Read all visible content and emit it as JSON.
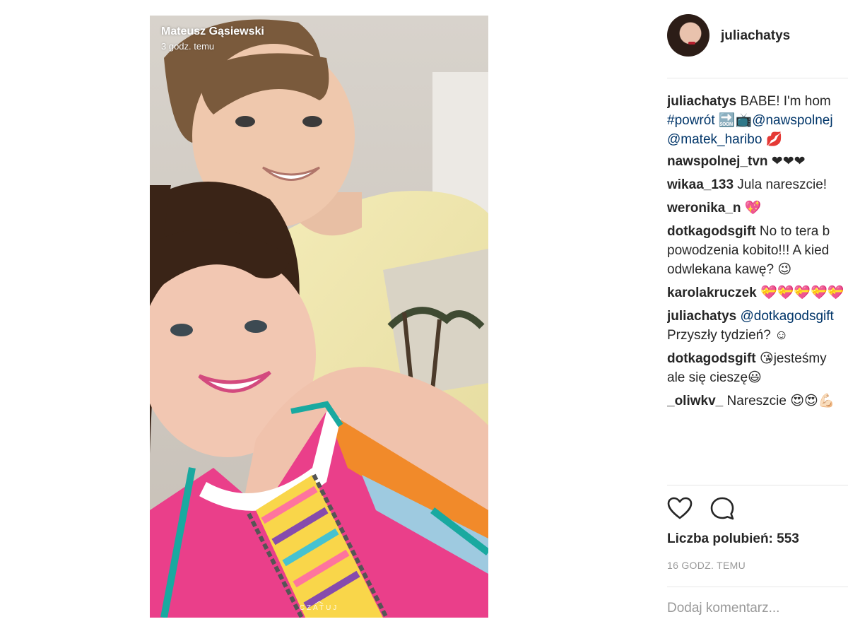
{
  "story": {
    "author": "Mateusz Gąsiewski",
    "time": "3 godz. temu",
    "chat_label": "CZATUJ"
  },
  "post": {
    "username": "juliachatys",
    "caption": {
      "user": "juliachatys",
      "text1": " BABE! I'm hom",
      "line2_tag": "#powrót",
      "line2_emoji": " 🔜📺",
      "line2_mention": "@nawspolnej",
      "line3_mention": "@matek_haribo",
      "line3_emoji": " 💋"
    },
    "comments": [
      {
        "user": "nawspolnej_tvn",
        "text": " ❤❤❤"
      },
      {
        "user": "wikaa_133",
        "text": " Jula nareszcie!"
      },
      {
        "user": "weronika_n",
        "text": " 💖"
      },
      {
        "user": "dotkagodsgift",
        "text": " No to tera b",
        "line2": "powodzenia kobito!!! A kied",
        "line3": "odwlekana kawę? 😉"
      },
      {
        "user": "karolakruczek",
        "text": " 💝💝💝💝💝"
      },
      {
        "user": "juliachatys",
        "mention": " @dotkagodsgift",
        "line2": "Przyszły tydzień? ☺"
      },
      {
        "user": "dotkagodsgift",
        "text": " 😘jesteśmy",
        "line2": "ale się cieszę😃"
      },
      {
        "user": "_oliwkv_",
        "text": " Nareszcie 😍😍💪🏻"
      }
    ],
    "likes": "Liczba polubień: 553",
    "time_ago": "16 GODZ. TEMU",
    "add_comment_placeholder": "Dodaj komentarz..."
  },
  "icons": {
    "like": "heart-outline-icon",
    "comment": "speech-bubble-icon"
  }
}
